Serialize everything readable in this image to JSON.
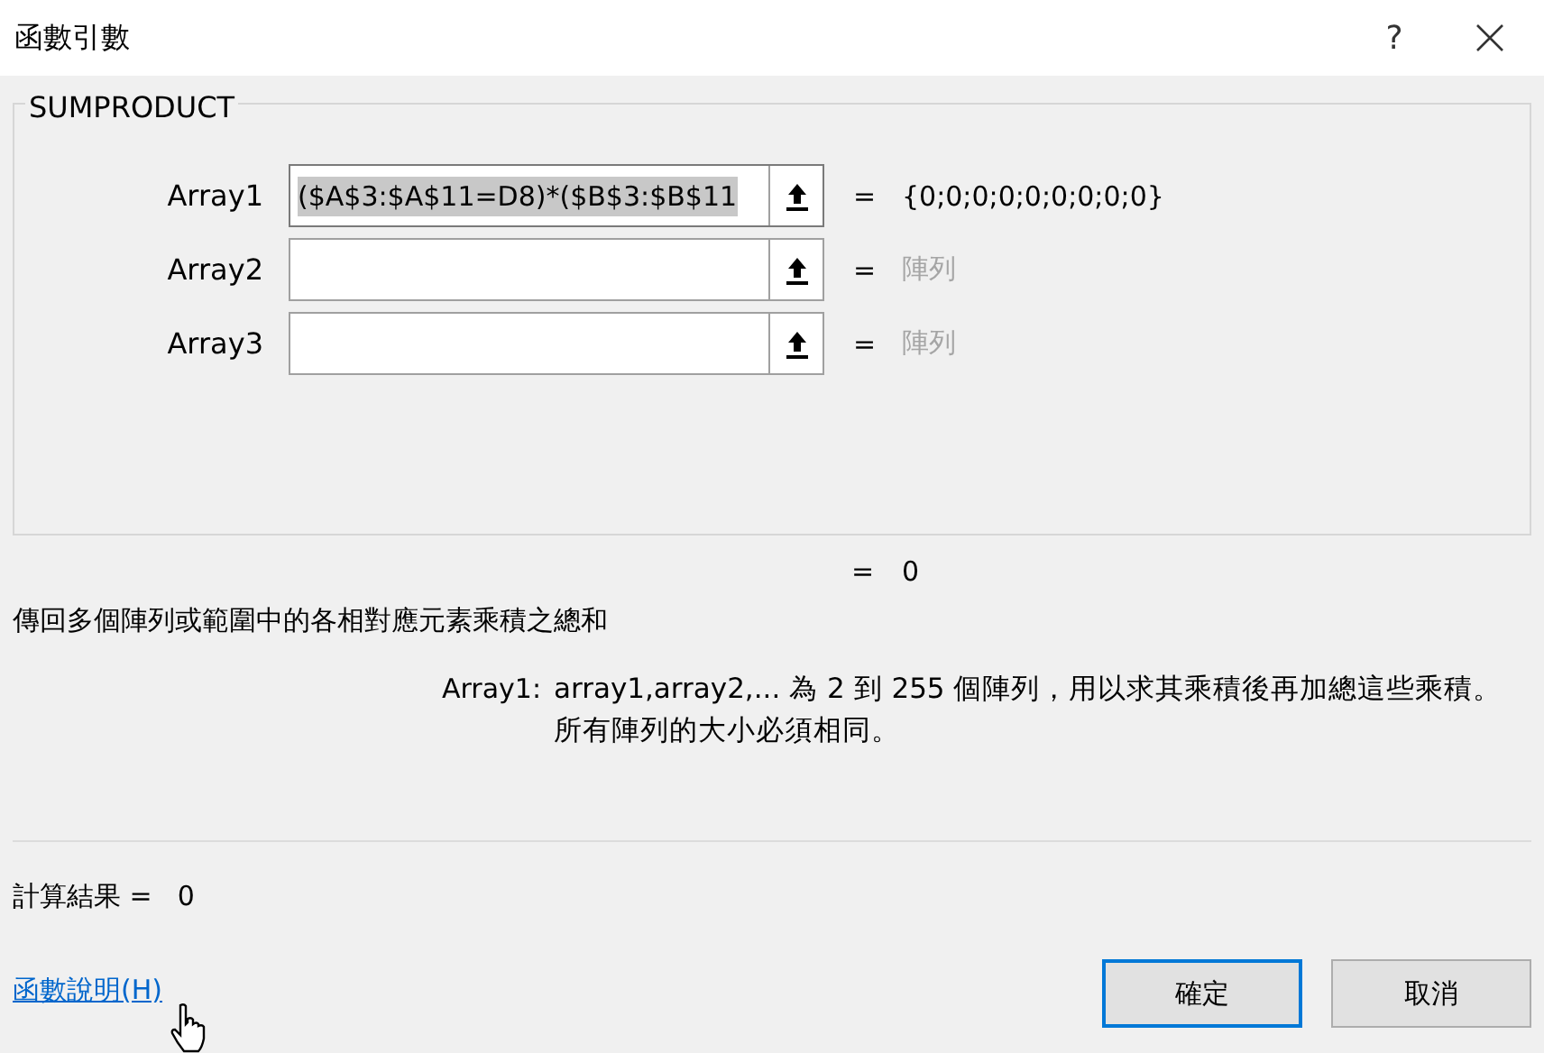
{
  "window": {
    "title": "函數引數",
    "help_button": "?"
  },
  "function_name": "SUMPRODUCT",
  "arguments": [
    {
      "label": "Array1",
      "value": "($A$3:$A$11=D8)*($B$3:$B$11",
      "text_selected": true,
      "equals": "=",
      "result": "{0;0;0;0;0;0;0;0;0}",
      "result_greyed": false
    },
    {
      "label": "Array2",
      "text_selected": false,
      "equals": "=",
      "result": "陣列",
      "result_greyed": true
    },
    {
      "label": "Array3",
      "text_selected": false,
      "equals": "=",
      "result": "陣列",
      "result_greyed": true
    }
  ],
  "formula_result": {
    "equals": "=",
    "value": "0"
  },
  "description": "傳回多個陣列或範圍中的各相對應元素乘積之總和",
  "argument_help": {
    "label": "Array1:",
    "text": "array1,array2,... 為 2 到 255 個陣列，用以求其乘積後再加總這些乘積。所有陣列的大小必須相同。"
  },
  "calculation": {
    "label": "計算結果 =",
    "value": "0"
  },
  "help_link": "函數說明(H)",
  "buttons": [
    {
      "label": "確定",
      "default": true
    },
    {
      "label": "取消",
      "default": false
    }
  ]
}
